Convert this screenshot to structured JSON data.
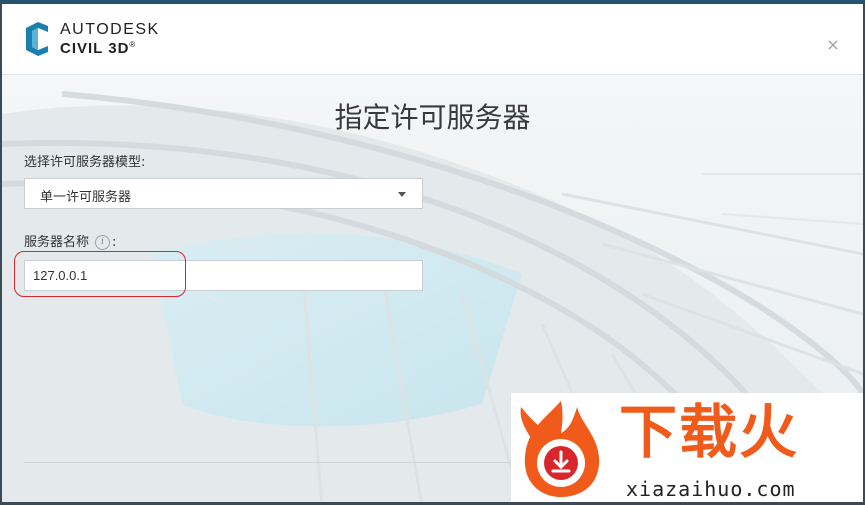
{
  "header": {
    "brand_top": "AUTODESK",
    "brand_bottom": "CIVIL 3D",
    "brand_mark": "®",
    "close_glyph": "×"
  },
  "page": {
    "title": "指定许可服务器"
  },
  "form": {
    "model_label": "选择许可服务器模型:",
    "model_value": "单一许可服务器",
    "server_name_label": "服务器名称",
    "server_name_colon": ":",
    "info_glyph": "i",
    "server_name_value": "127.0.0.1"
  },
  "watermark": {
    "chinese": "下载火",
    "domain": "xiazaihuo.com"
  },
  "colors": {
    "window_border": "#27536e",
    "highlight": "#d9252c",
    "watermark_orange": "#f05a1a",
    "logo_blue": "#1b7fae"
  }
}
